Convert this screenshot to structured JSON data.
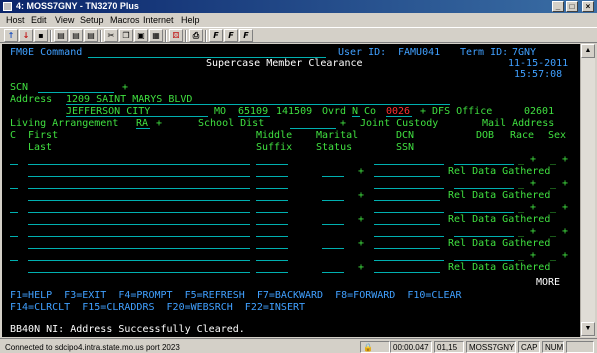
{
  "window": {
    "title": "4: MOSS7GNY - TN3270 Plus"
  },
  "menu": [
    "Host",
    "Edit",
    "View",
    "Setup",
    "Macros",
    "Internet",
    "Help"
  ],
  "screen": {
    "command_label": "FM0E Command",
    "user_label": "User ID:",
    "user_id": "FAMU041",
    "term_label": "Term ID:",
    "term_id": "7GNY",
    "title": "Supercase Member Clearance",
    "date": "11-15-2011",
    "time": "15:57:08",
    "scn_label": "SCN",
    "address_label": "Address",
    "address": "1209 SAINT MARYS BLVD",
    "city": "JEFFERSON CITY",
    "state": "MO",
    "zip": "65109",
    "zip_ext": "141509",
    "ovrd_label": "Ovrd",
    "ovrd": "N",
    "co_label": "Co",
    "county": "0026",
    "dfs_label": "+ DFS Office",
    "dfs_office": "02601",
    "living_label": "Living Arrangement",
    "living_value": "RA",
    "school_label": "School Dist",
    "joint_label": "Joint Custody",
    "mail_label": "Mail Address",
    "headers": {
      "c": "C",
      "first": "First",
      "last": "Last",
      "middle": "Middle",
      "suffix": "Suffix",
      "marital": "Marital",
      "status": "Status",
      "dcn": "DCN",
      "ssn": "SSN",
      "dob": "DOB",
      "race": "Race",
      "sex": "Sex"
    },
    "rel_text": "Rel Data Gathered",
    "more": "MORE",
    "pf1": "F1=HELP  F3=EXIT  F4=PROMPT  F5=REFRESH  F7=BACKWARD  F8=FORWARD  F10=CLEAR",
    "pf2": "F14=CLRCLT  F15=CLRADDRS  F20=WEBSRCH  F22=INSERT",
    "message": "BB40N NI: Address Successfully Cleared."
  },
  "status": {
    "connection": "Connected to sdcipo4.intra.state.mo.us port 2023",
    "timer": "00:00.047",
    "cursor": "01,15",
    "session": "MOSS7GNY",
    "caps": "CAP",
    "num": "NUM"
  }
}
